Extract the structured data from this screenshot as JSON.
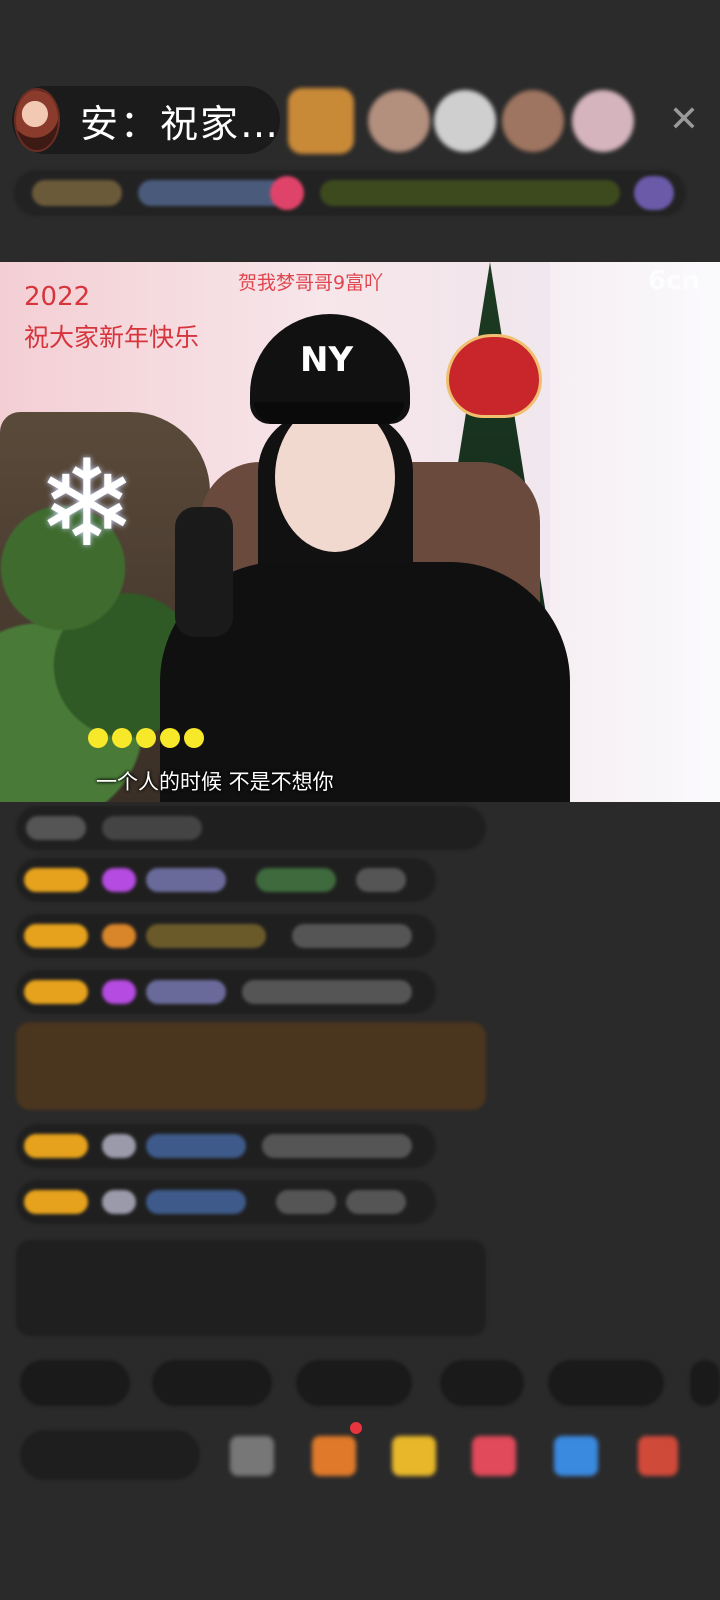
{
  "header": {
    "host_name": "安：祝家…",
    "close_symbol": "✕",
    "viewer_colors": [
      "#e0a04a",
      "#b89a8a",
      "#c8c8c8",
      "#a07860",
      "#d8b8c0"
    ]
  },
  "video": {
    "overlay_year": "2022",
    "overlay_greeting": "祝大家新年快乐",
    "overlay_top_text": "贺我梦哥哥9富吖",
    "platform_logo": "6cn",
    "cap_logo": "NY",
    "lyric": "一个人的时候  不是不想你",
    "lyric_dots": 5
  },
  "icons": {
    "close": "close-icon",
    "snowflake": "snowflake-icon",
    "microphone": "microphone-icon"
  }
}
